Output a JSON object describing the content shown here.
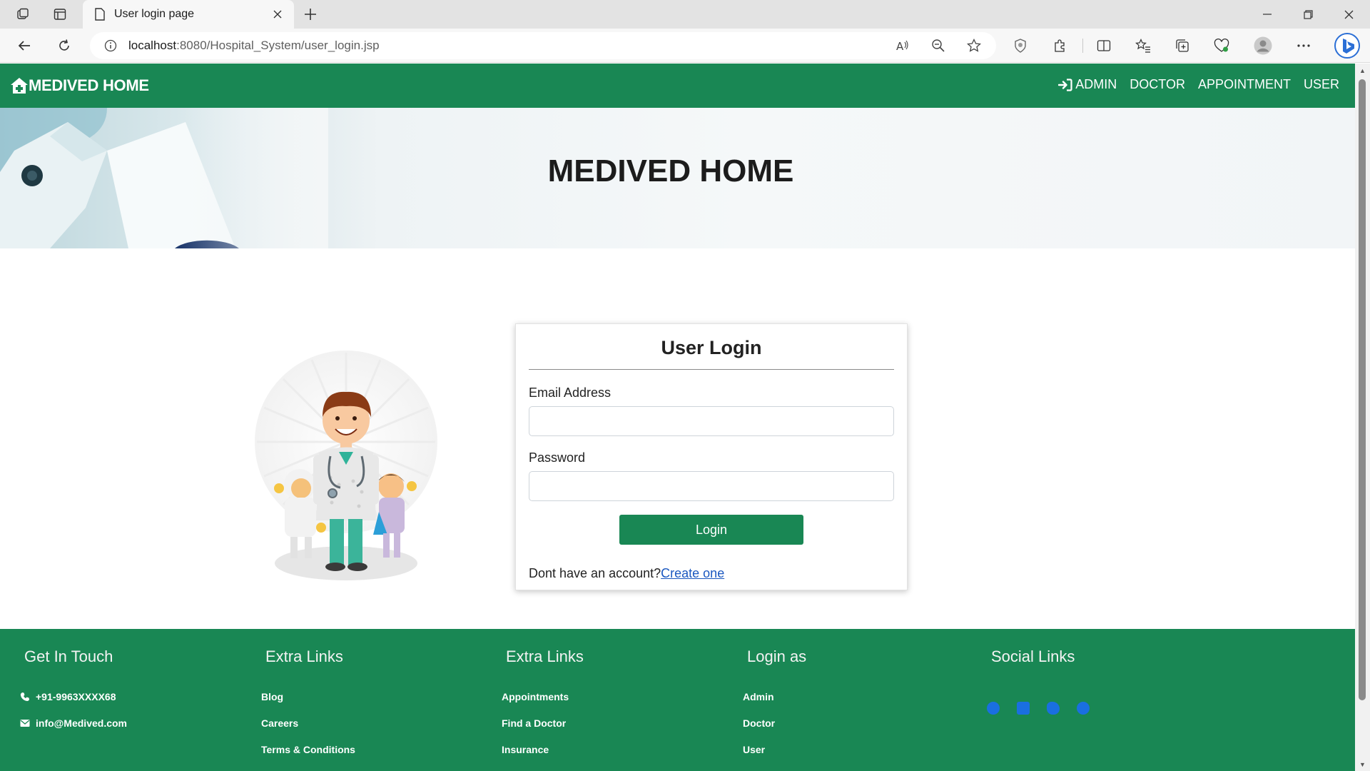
{
  "browser": {
    "tab_title": "User login page",
    "url_host": "localhost",
    "url_path": ":8080/Hospital_System/user_login.jsp"
  },
  "navbar": {
    "brand": "MEDIVED HOME",
    "links": [
      "ADMIN",
      "DOCTOR",
      "APPOINTMENT",
      "USER"
    ]
  },
  "hero": {
    "title": "MEDIVED HOME"
  },
  "login": {
    "title": "User Login",
    "email_label": "Email Address",
    "email_value": "",
    "password_label": "Password",
    "password_value": "",
    "button": "Login",
    "signup_prompt": "Dont have an account?",
    "signup_link": "Create one"
  },
  "footer": {
    "col1": {
      "title": "Get In Touch",
      "items": [
        "+91-9963XXXX68",
        "info@Medived.com"
      ]
    },
    "col2": {
      "title": "Extra Links",
      "items": [
        "Blog",
        "Careers",
        "Terms & Conditions"
      ]
    },
    "col3": {
      "title": "Extra Links",
      "items": [
        "Appointments",
        "Find a Doctor",
        "Insurance"
      ]
    },
    "col4": {
      "title": "Login as",
      "items": [
        "Admin",
        "Doctor",
        "User"
      ]
    },
    "col5": {
      "title": "Social Links",
      "icons": [
        "facebook-icon",
        "linkedin-icon",
        "twitter-icon",
        "instagram-icon"
      ]
    }
  },
  "colors": {
    "brand_green": "#198754",
    "link_blue": "#1b58c0"
  }
}
